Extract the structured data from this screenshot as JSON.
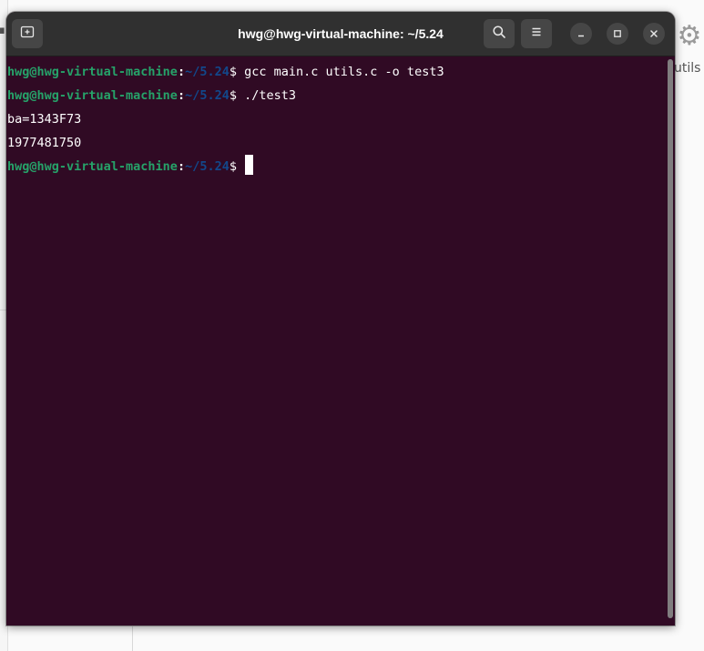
{
  "window": {
    "title": "hwg@hwg-virtual-machine: ~/5.24"
  },
  "terminal": {
    "lines": [
      {
        "kind": "prompt",
        "user_host": "hwg@hwg-virtual-machine",
        "sep": ":",
        "dir": "~/5.24",
        "symbol": "$",
        "command": " gcc main.c utils.c -o test3"
      },
      {
        "kind": "prompt",
        "user_host": "hwg@hwg-virtual-machine",
        "sep": ":",
        "dir": "~/5.24",
        "symbol": "$",
        "command": " ./test3"
      },
      {
        "kind": "output",
        "text": "ba=1343F73"
      },
      {
        "kind": "output",
        "text": "1977481750"
      },
      {
        "kind": "prompt",
        "user_host": "hwg@hwg-virtual-machine",
        "sep": ":",
        "dir": "~/5.24",
        "symbol": "$",
        "command": ""
      }
    ]
  },
  "background": {
    "right_label": "utils"
  },
  "colors": {
    "terminal_bg": "#300a24",
    "prompt_user": "#26a269",
    "prompt_dir": "#12488b",
    "titlebar": "#303030"
  },
  "icons": [
    "new-tab-icon",
    "search-icon",
    "menu-icon",
    "minimize-icon",
    "maximize-icon",
    "close-icon",
    "gear-icon"
  ]
}
